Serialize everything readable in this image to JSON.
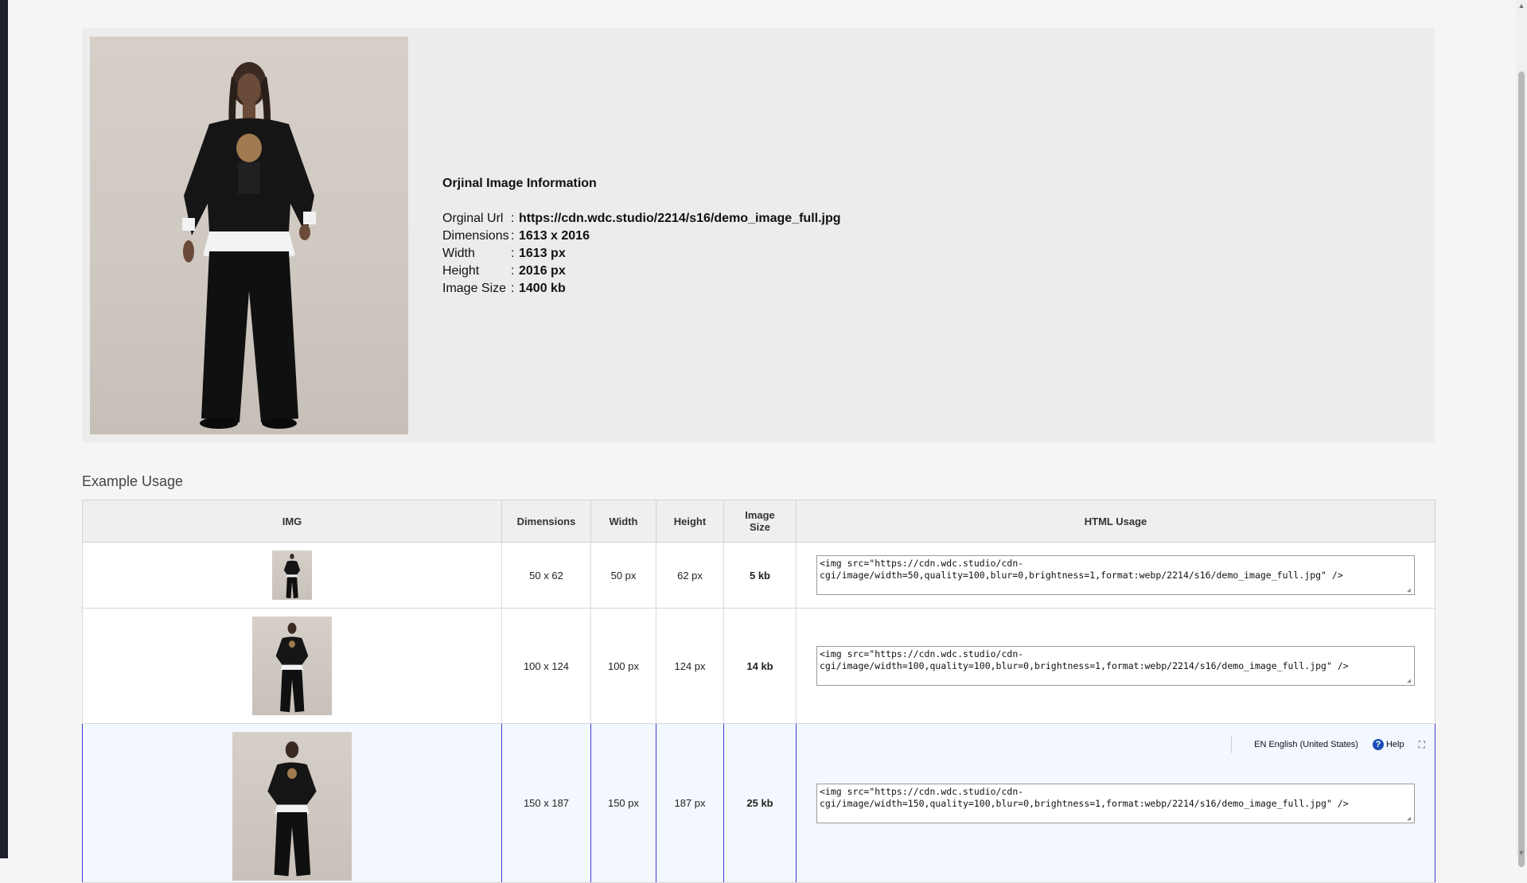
{
  "info": {
    "title": "Orjinal Image Information",
    "rows": [
      {
        "label": "Orginal Url",
        "sep": ":",
        "value": "https://cdn.wdc.studio/2214/s16/demo_image_full.jpg"
      },
      {
        "label": "Dimensions",
        "sep": ":",
        "value": "1613 x 2016"
      },
      {
        "label": "Width",
        "sep": ":",
        "value": "1613 px"
      },
      {
        "label": "Height",
        "sep": ":",
        "value": "2016 px"
      },
      {
        "label": "Image Size",
        "sep": ":",
        "value": "1400 kb"
      }
    ]
  },
  "usage": {
    "title": "Example Usage",
    "headers": {
      "img": "IMG",
      "dimensions": "Dimensions",
      "width": "Width",
      "height": "Height",
      "size_line1": "Image",
      "size_line2": "Size",
      "html": "HTML Usage"
    },
    "rows": [
      {
        "dimensions": "50 x 62",
        "width": "50 px",
        "height": "62 px",
        "size": "5 kb",
        "code": "<img src=\"https://cdn.wdc.studio/cdn-cgi/image/width=50,quality=100,blur=0,brightness=1,format:webp/2214/s16/demo_image_full.jpg\" />"
      },
      {
        "dimensions": "100 x 124",
        "width": "100 px",
        "height": "124 px",
        "size": "14 kb",
        "code": "<img src=\"https://cdn.wdc.studio/cdn-cgi/image/width=100,quality=100,blur=0,brightness=1,format:webp/2214/s16/demo_image_full.jpg\" />"
      },
      {
        "dimensions": "150 x 187",
        "width": "150 px",
        "height": "187 px",
        "size": "25 kb",
        "code": "<img src=\"https://cdn.wdc.studio/cdn-cgi/image/width=150,quality=100,blur=0,brightness=1,format:webp/2214/s16/demo_image_full.jpg\" />"
      }
    ]
  },
  "lang_bar": {
    "language": "EN English (United States)",
    "help": "Help"
  },
  "icons": {
    "help": "help-circle-icon",
    "expand": "expand-icon",
    "scroll_up": "scroll-up-arrow-icon",
    "scroll_down": "scroll-down-arrow-icon"
  },
  "colors": {
    "highlight_border": "#3a3ad0",
    "help_blue": "#1b4fb5"
  }
}
